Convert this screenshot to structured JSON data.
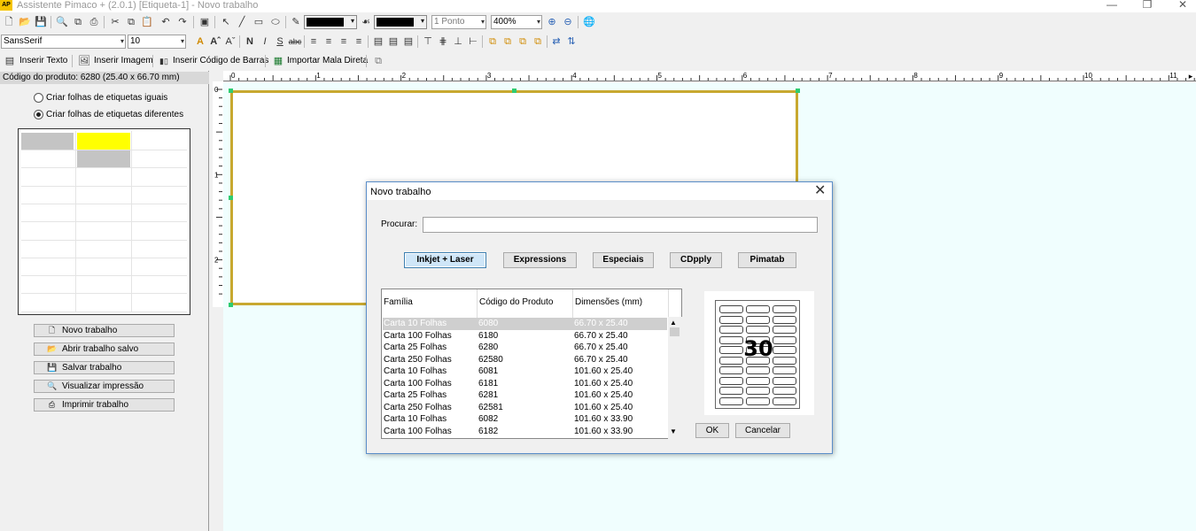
{
  "window": {
    "app_logo": "AP",
    "title": "Assistente Pimaco + (2.0.1)  [Etiqueta-1] - Novo trabalho",
    "controls": [
      "minimize-icon",
      "restore-icon",
      "close-icon"
    ]
  },
  "toolbar1": {
    "line_width": "1 Ponto",
    "zoom": "400%",
    "icons": [
      "new-icon",
      "open-icon",
      "save-icon",
      "print-preview-icon",
      "copy-page-icon",
      "page-icon",
      "print-icon",
      "cut-icon",
      "copy-icon",
      "paste-icon",
      "undo-icon",
      "redo-icon",
      "frame-icon",
      "pointer-icon",
      "line-icon",
      "rectangle-icon",
      "ellipse-icon",
      "pen-color-icon",
      "fill-color-icon",
      "zoom-in-icon",
      "zoom-out-icon",
      "web-icon"
    ],
    "pen_color": "#000000",
    "fill_color": "#000000"
  },
  "toolbar2": {
    "font_family": "SansSerif",
    "font_size": "10",
    "bold": "N",
    "italic": "I",
    "underline": "S",
    "strikethrough": "abc"
  },
  "toolbar3": {
    "insert_text": "Inserir Texto",
    "insert_image": "Inserir Imagem",
    "insert_barcode": "Inserir Código de Barras",
    "import_mail": "Importar Mala Direta"
  },
  "left_panel": {
    "product_code": "Código do produto: 6280 (25.40 x 66.70 mm)",
    "radio_equal": "Criar folhas de etiquetas iguais",
    "radio_different": "Criar folhas de etiquetas diferentes",
    "selected_radio": "different",
    "buttons": {
      "new": "Novo trabalho",
      "open": "Abrir trabalho salvo",
      "save": "Salvar trabalho",
      "preview": "Visualizar impressão",
      "print": "Imprimir trabalho"
    },
    "grid_colors": {
      "gray": "#c4c4c4",
      "yellow": "#ffff00"
    }
  },
  "rulers": {
    "top_numbers": [
      "0",
      "1",
      "2",
      "3",
      "4",
      "5",
      "6",
      "7",
      "8",
      "9",
      "10",
      "11"
    ],
    "left_numbers": [
      "0",
      "1",
      "2"
    ]
  },
  "dialog": {
    "title": "Novo trabalho",
    "search_label": "Procurar:",
    "search_value": "",
    "categories": [
      "Inkjet + Laser",
      "Expressions",
      "Especiais",
      "CDpply",
      "Pimatab"
    ],
    "selected_category": "Inkjet + Laser",
    "columns": [
      "Família",
      "Código do Produto",
      "Dimensões (mm)"
    ],
    "rows": [
      [
        "Carta 10 Folhas",
        "6080",
        "66.70 x 25.40"
      ],
      [
        "Carta 100 Folhas",
        "6180",
        "66.70 x 25.40"
      ],
      [
        "Carta 25 Folhas",
        "6280",
        "66.70 x 25.40"
      ],
      [
        "Carta 250 Folhas",
        "62580",
        "66.70 x 25.40"
      ],
      [
        "Carta 10 Folhas",
        "6081",
        "101.60 x 25.40"
      ],
      [
        "Carta 100 Folhas",
        "6181",
        "101.60 x 25.40"
      ],
      [
        "Carta 25 Folhas",
        "6281",
        "101.60 x 25.40"
      ],
      [
        "Carta 250 Folhas",
        "62581",
        "101.60 x 25.40"
      ],
      [
        "Carta 10 Folhas",
        "6082",
        "101.60 x 33.90"
      ],
      [
        "Carta 100 Folhas",
        "6182",
        "101.60 x 33.90"
      ]
    ],
    "selected_row": 0,
    "preview_count": "30",
    "ok": "OK",
    "cancel": "Cancelar"
  }
}
